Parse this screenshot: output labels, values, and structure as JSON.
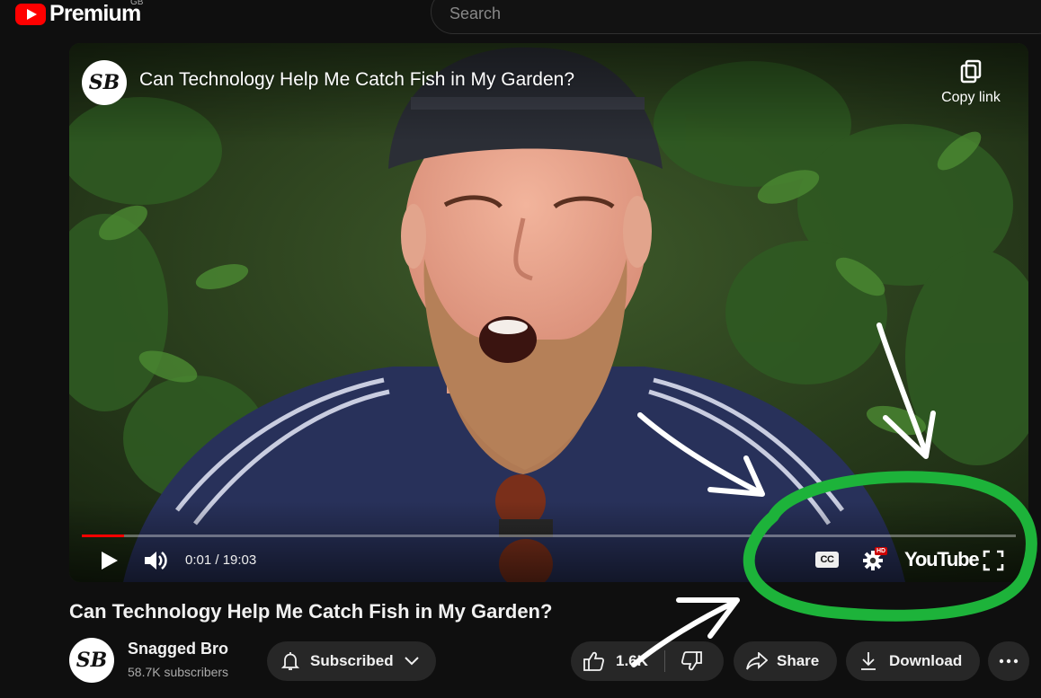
{
  "masthead": {
    "logo_text": "Premium",
    "country_code": "GB",
    "search_placeholder": "Search"
  },
  "player": {
    "channel_avatar_text": "SB",
    "title": "Can Technology Help Me Catch Fish in My Garden?",
    "copy_link_label": "Copy link",
    "time_display": "0:01 / 19:03",
    "progress_fraction": 0.005,
    "cc_label": "CC",
    "hd_badge": "HD",
    "youtube_wordmark": "YouTube"
  },
  "video": {
    "title": "Can Technology Help Me Catch Fish in My Garden?"
  },
  "owner": {
    "avatar_text": "SB",
    "name": "Snagged Bro",
    "subscribers": "58.7K subscribers"
  },
  "actions": {
    "subscribed_label": "Subscribed",
    "like_count": "1.6K",
    "share_label": "Share",
    "download_label": "Download"
  },
  "colors": {
    "brand_red": "#ff0000",
    "annotation_green": "#1db33a",
    "annotation_white": "#ffffff"
  }
}
